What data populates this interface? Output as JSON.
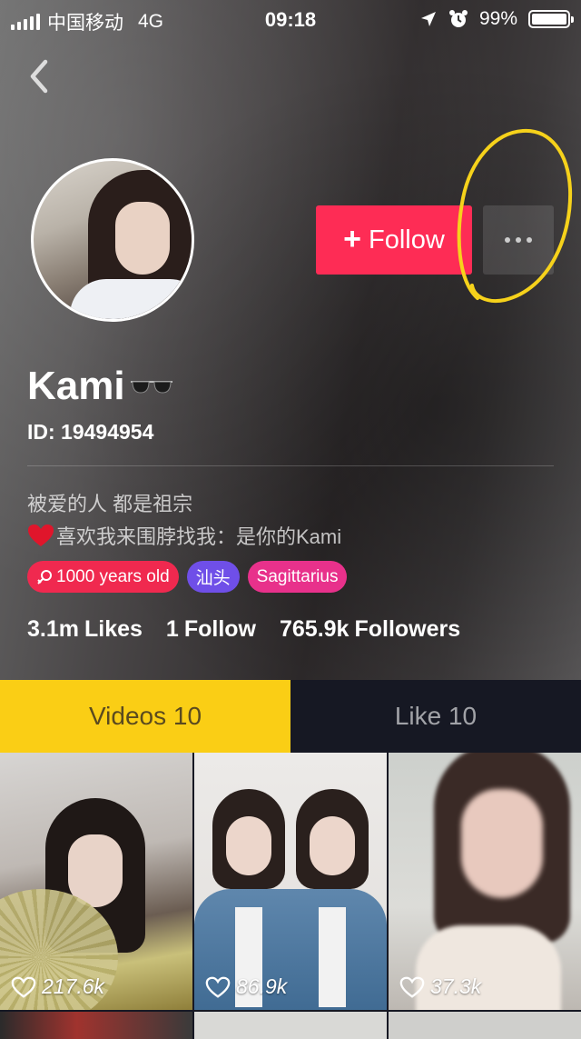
{
  "status_bar": {
    "carrier": "中国移动",
    "network": "4G",
    "time": "09:18",
    "battery": "99%",
    "battery_level": 0.99
  },
  "profile": {
    "name": "Kami",
    "id_label": "ID: 19494954",
    "bio_line1": "被爱的人 都是祖宗",
    "bio_line2": "喜欢我来围脖找我：是你的Kami",
    "tags": [
      {
        "label": "1000 years old",
        "color": "#f0294f"
      },
      {
        "label": "汕头",
        "color": "#6f4fe8"
      },
      {
        "label": "Sagittarius",
        "color": "#e8318b"
      }
    ],
    "stats": [
      {
        "value": "3.1m",
        "label": "Likes"
      },
      {
        "value": "1",
        "label": "Follow"
      },
      {
        "value": "765.9k",
        "label": "Followers"
      }
    ]
  },
  "actions": {
    "follow_plus": "+",
    "follow_label": "Follow"
  },
  "tabs": [
    {
      "label": "Videos 10",
      "active": true
    },
    {
      "label": "Like 10",
      "active": false
    }
  ],
  "videos": [
    {
      "likes": "217.6k"
    },
    {
      "likes": "86.9k"
    },
    {
      "likes": "37.3k"
    }
  ],
  "colors": {
    "accent": "#fe2c55",
    "tab_active": "#face15",
    "background": "#161823",
    "annotation": "#f6d21b"
  }
}
